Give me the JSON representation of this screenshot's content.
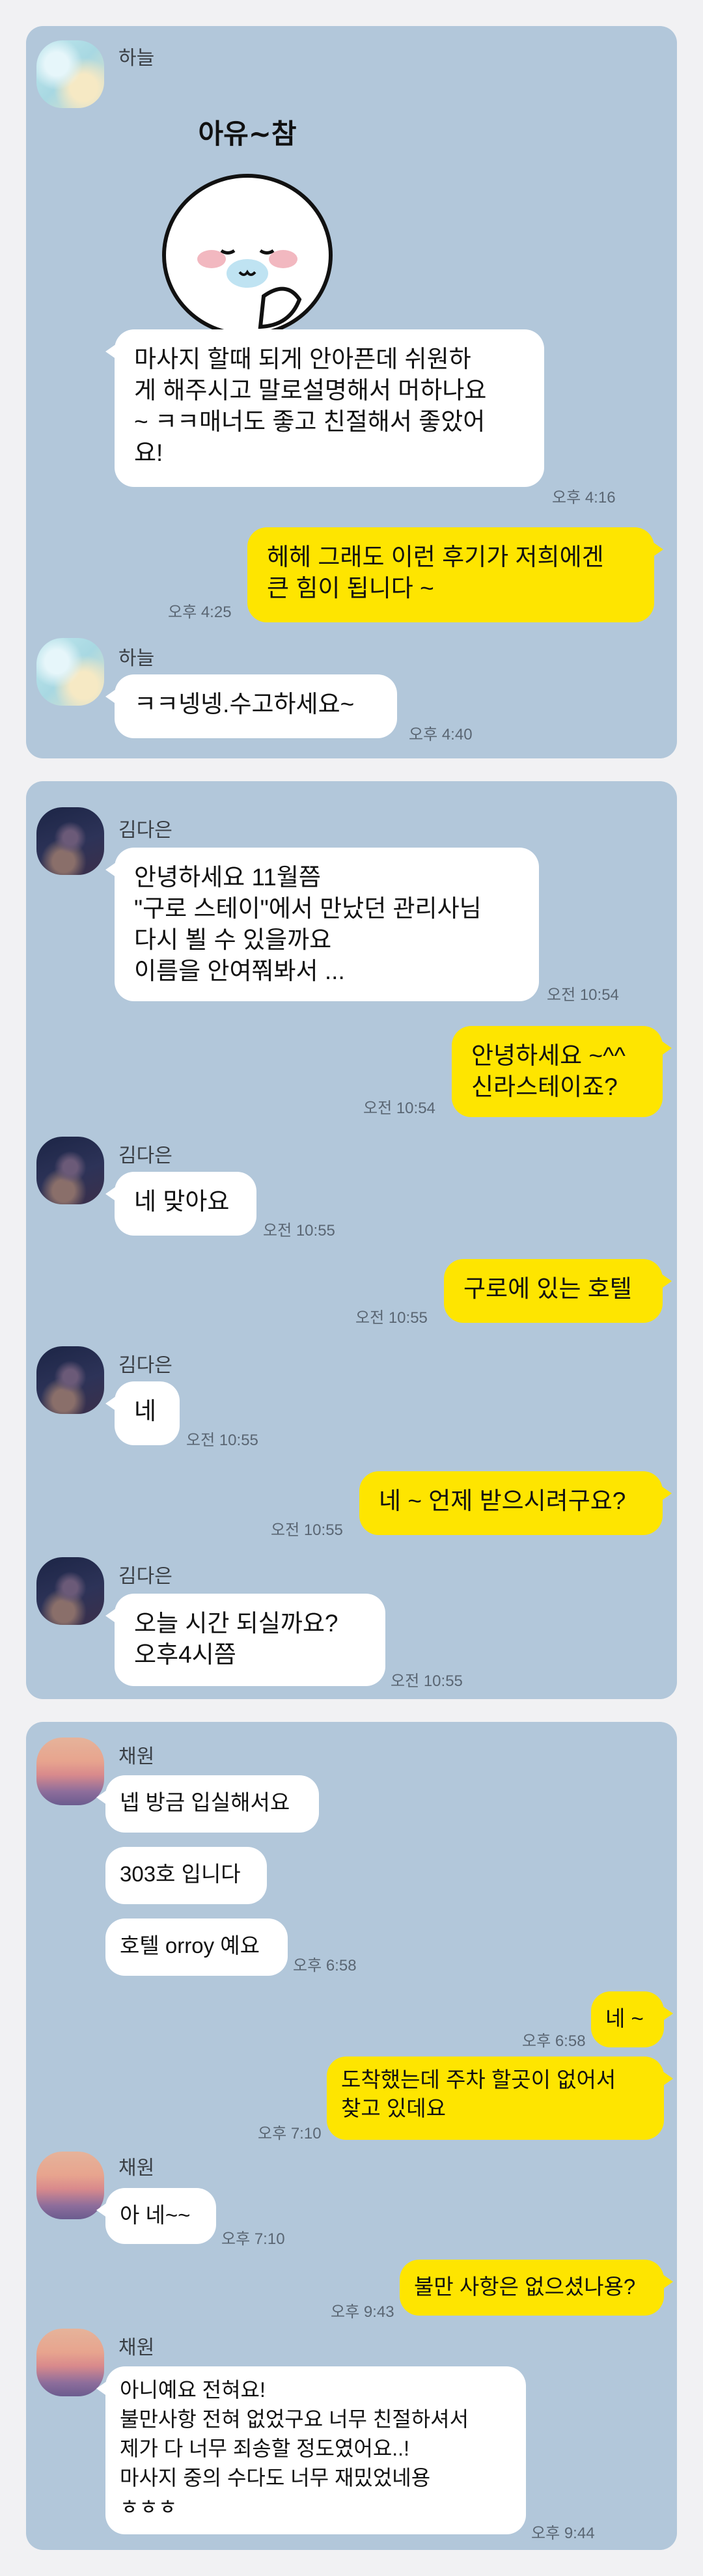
{
  "chat1": {
    "sender": "하늘",
    "sticker_text": "아유~참",
    "msg1": "마사지 할때 되게 안아픈데 쉬원하\n게 해주시고 말로설명해서 머하나요\n~ ㅋㅋ매너도 좋고 친절해서 좋았어\n요!",
    "msg1_time": "오후 4:16",
    "reply1": "헤헤 그래도 이런 후기가 저희에겐\n큰 힘이 됩니다 ~",
    "reply1_time": "오후 4:25",
    "sender2": "하늘",
    "msg2": "ㅋㅋ넹넹.수고하세요~",
    "msg2_time": "오후 4:40"
  },
  "chat2": {
    "sender": "김다은",
    "msg1": "안녕하세요 11월쯤\n\"구로 스테이\"에서 만났던 관리사님\n다시 뵐 수 있을까요\n이름을 안여쭤봐서 ...",
    "msg1_time": "오전 10:54",
    "reply1": "안녕하세요 ~^^\n신라스테이죠?",
    "reply1_time": "오전 10:54",
    "msg2": "네 맞아요",
    "msg2_time": "오전 10:55",
    "reply2": "구로에 있는 호텔",
    "reply2_time": "오전 10:55",
    "msg3": "네",
    "msg3_time": "오전 10:55",
    "reply3": "네 ~ 언제 받으시려구요?",
    "reply3_time": "오전 10:55",
    "msg4": "오늘  시간 되실까요?\n오후4시쯤",
    "msg4_time": "오전 10:55"
  },
  "chat3": {
    "sender": "채원",
    "msg1": "넵 방금 입실해서요",
    "msg2": "303호 입니다",
    "msg3": "호텔 orroy 예요",
    "msg3_time": "오후 6:58",
    "reply1": "네 ~",
    "reply1_time": "오후 6:58",
    "reply2": "도착했는데  주차 할곳이 없어서\n찾고 있데요",
    "reply2_time": "오후 7:10",
    "msg4": "아 네~~",
    "msg4_time": "오후 7:10",
    "reply3": "불만 사항은 없으셨나용?",
    "reply3_time": "오후 9:43",
    "msg5": "아니예요 전혀요!\n불만사항 전혀 없었구요 너무 친절하셔서\n제가 다 너무 죄송할 정도였어요..!\n마사지 중의 수다도 너무 재밌었네용\nㅎㅎㅎ",
    "msg5_time": "오후 9:44"
  },
  "colors": {
    "chat_bg": "#b2c7da",
    "incoming_bubble": "#ffffff",
    "outgoing_bubble": "#fee500"
  },
  "icons": [
    "blurred-avatar",
    "smiling-character-sticker"
  ]
}
